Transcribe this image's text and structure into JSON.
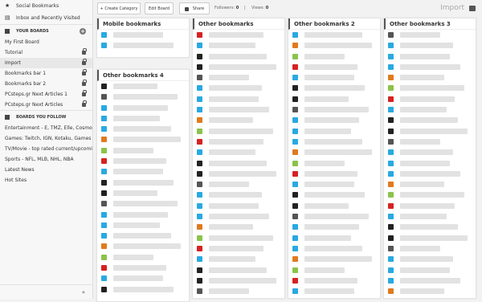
{
  "sidebar": {
    "top_items": [
      {
        "label": "Social Bookmarks",
        "icon": "star-icon"
      },
      {
        "label": "Inbox and Recently Visited",
        "icon": "inbox-icon"
      }
    ],
    "your_boards_header": "YOUR BOARDS",
    "boards": [
      {
        "label": "My First Board",
        "locked": false,
        "active": false
      },
      {
        "label": "Tutorial",
        "locked": true,
        "active": false
      },
      {
        "label": "Import",
        "locked": true,
        "active": true
      },
      {
        "label": "Bookmarks bar 1",
        "locked": true,
        "active": false
      },
      {
        "label": "Bookmarks bar 2",
        "locked": true,
        "active": false
      },
      {
        "label": "PCsteps.gr Next Articles 1",
        "locked": true,
        "active": false
      },
      {
        "label": "PCsteps.gr Next Articles",
        "locked": true,
        "active": false
      }
    ],
    "follow_header": "BOARDS YOU FOLLOW",
    "followed": [
      "Entertainment - E, TMZ, Elle, Cosmo",
      "Games: Twitch, IGN, Kotaku, Games F",
      "TV/Movie - top rated current/upcomi",
      "Sports - NFL, MLB, NHL, NBA",
      "Latest News",
      "Hot Sites"
    ],
    "collapse_label": "«"
  },
  "toolbar": {
    "create_category": "+ Create Category",
    "edit_board": "Edit Board",
    "share": "Share",
    "followers_label": "Followers:",
    "followers_value": "0",
    "separator": "|",
    "views_label": "Views:",
    "views_value": "0",
    "board_title": "Import"
  },
  "columns": [
    {
      "title": "Mobile bookmarks",
      "count": 2
    },
    {
      "title": "Other bookmarks 4",
      "count": 20
    },
    {
      "title": "Other bookmarks",
      "count": 25
    },
    {
      "title": "Other bookmarks 2",
      "count": 25
    },
    {
      "title": "Other bookmarks 3",
      "count": 25
    }
  ],
  "colors": {
    "accent_blue": "#29a9e1",
    "youtube_red": "#d62222",
    "dark": "#222222"
  }
}
